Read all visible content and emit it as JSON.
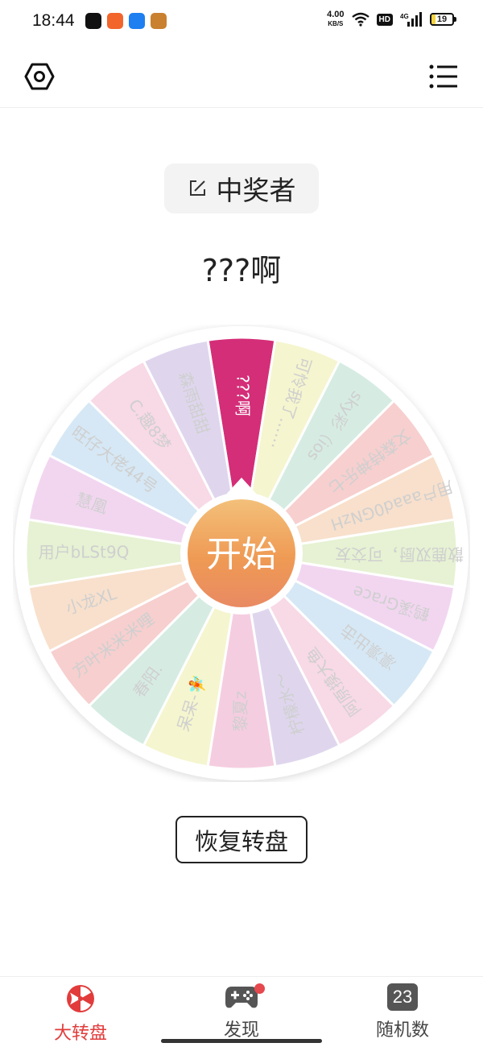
{
  "status_bar": {
    "time": "18:44",
    "net_speed": "4.00",
    "net_speed_unit": "KB/S",
    "hd": "HD",
    "signal": "4G",
    "battery": "19",
    "battery_level": 0.19
  },
  "winner": {
    "label": "中奖者",
    "name": "???啊"
  },
  "wheel": {
    "start_label": "开始",
    "pointer_color": "#d62e7a",
    "segments": [
      {
        "label": "???啊",
        "color": "#d42e78",
        "text_color": "#ffffff"
      },
      {
        "label": "可怜我了……",
        "color": "#f5f5cf",
        "text_color": "#cfcfcf"
      },
      {
        "label": "sky彩（ios",
        "color": "#d6ece3",
        "text_color": "#cfcfcf"
      },
      {
        "label": "文森特神乐七",
        "color": "#f7cfcf",
        "text_color": "#cfcfcf"
      },
      {
        "label": "用户aaad0GNzH",
        "color": "#f8e0cc",
        "text_color": "#cfcfcf"
      },
      {
        "label": "散鹿双厨，可交友",
        "color": "#e6f2d3",
        "text_color": "#cfcfcf"
      },
      {
        "label": "鹤溪Grace",
        "color": "#f2d6f0",
        "text_color": "#cfcfcf"
      },
      {
        "label": "凛凛出击",
        "color": "#d6e8f5",
        "text_color": "#cfcfcf"
      },
      {
        "label": "阿原摸大鱼",
        "color": "#f8d9e6",
        "text_color": "#cfcfcf"
      },
      {
        "label": "柠檬水～",
        "color": "#dfd6ee",
        "text_color": "#cfcfcf"
      },
      {
        "label": "黎夏z",
        "color": "#f5cde0",
        "text_color": "#cfcfcf"
      },
      {
        "label": "呆呆-🧚",
        "color": "#f5f5cf",
        "text_color": "#cfcfcf"
      },
      {
        "label": "春阳.",
        "color": "#d6ece3",
        "text_color": "#cfcfcf"
      },
      {
        "label": "方叶米米米哩",
        "color": "#f7cfcf",
        "text_color": "#cfcfcf"
      },
      {
        "label": "小龙XL",
        "color": "#f8e0cc",
        "text_color": "#cfcfcf"
      },
      {
        "label": "用户bLSt9Q",
        "color": "#e6f2d3",
        "text_color": "#cfcfcf"
      },
      {
        "label": "慧凰",
        "color": "#f2d6f0",
        "text_color": "#cfcfcf"
      },
      {
        "label": "旺仔大佬44号",
        "color": "#d6e8f5",
        "text_color": "#cfcfcf"
      },
      {
        "label": "C.趣8梦",
        "color": "#f8d9e6",
        "text_color": "#cfcfcf"
      },
      {
        "label": "森雨甜甜",
        "color": "#dfd6ee",
        "text_color": "#cfcfcf"
      }
    ]
  },
  "reset_label": "恢复转盘",
  "nav": {
    "items": [
      {
        "label": "大转盘",
        "active": true
      },
      {
        "label": "发现",
        "active": false
      },
      {
        "label": "随机数",
        "active": false,
        "icon_text": "23"
      }
    ]
  }
}
